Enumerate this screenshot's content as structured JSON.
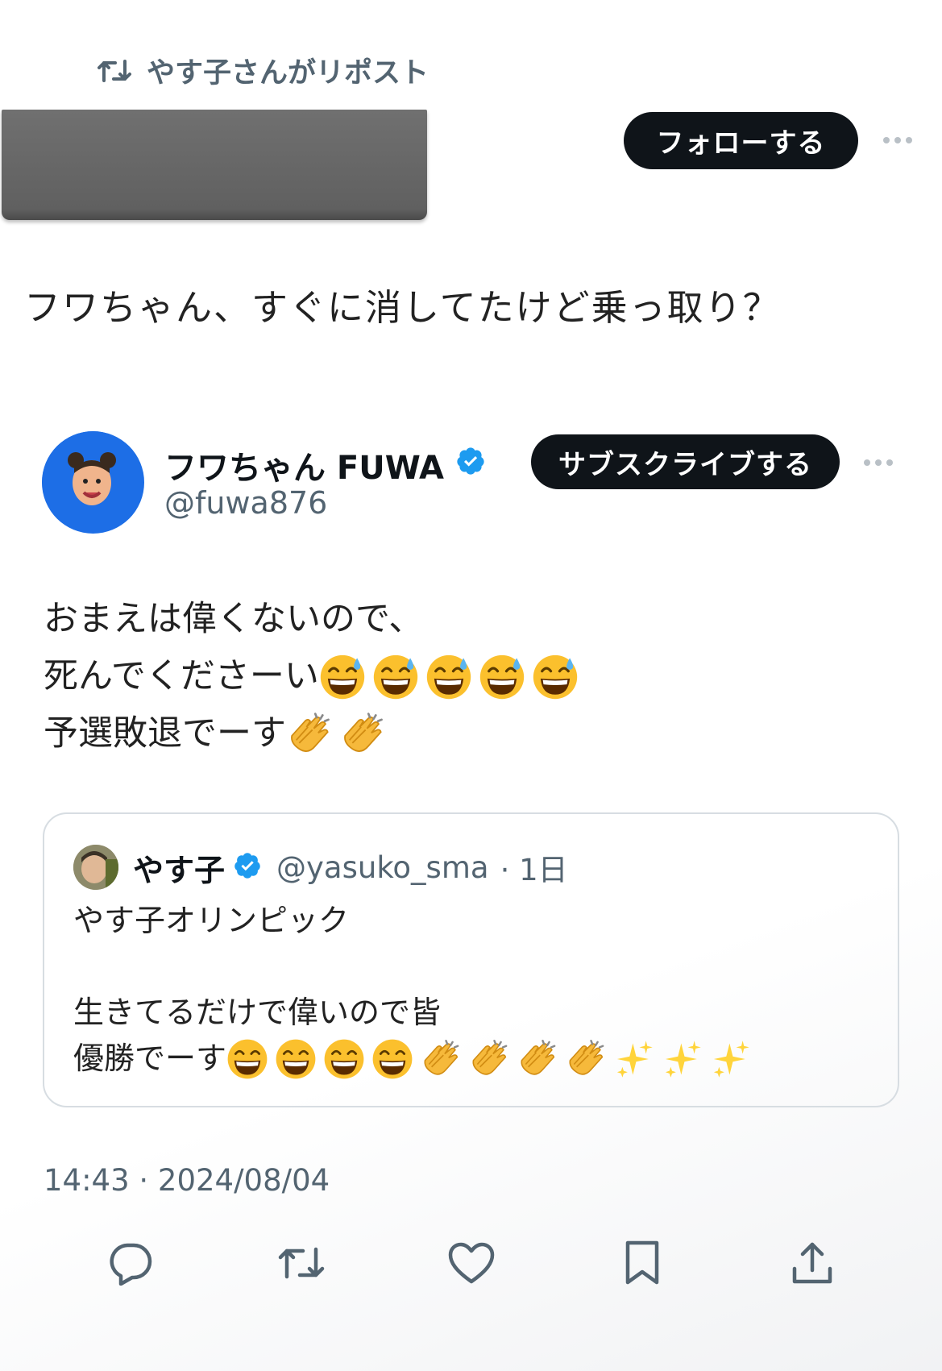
{
  "repost": {
    "icon": "repost-icon",
    "label": "やす子さんがリポスト"
  },
  "top": {
    "follow_label": "フォローする",
    "more_icon": "more-icon"
  },
  "quote_text": "フワちゃん、すぐに消してたけど乗っ取り？",
  "embedded": {
    "display_name": "フワちゃん FUWA",
    "handle": "@fuwa876",
    "subscribe_label": "サブスクライブする",
    "verified_color": "#1d9bf0",
    "body_lines": [
      {
        "text": "おまえは偉くないので、",
        "emojis": []
      },
      {
        "text": "死んでくださーい",
        "emojis": [
          "sweat-smile",
          "sweat-smile",
          "sweat-smile",
          "sweat-smile",
          "sweat-smile"
        ]
      },
      {
        "text": "予選敗退でーす",
        "emojis": [
          "clap",
          "clap"
        ]
      }
    ]
  },
  "quoted": {
    "display_name": "やす子",
    "handle": "@yasuko_sma",
    "time": "· 1日",
    "lines": [
      {
        "text": "やす子オリンピック",
        "emojis": []
      },
      {
        "text": "",
        "emojis": []
      },
      {
        "text": "生きてるだけで偉いので皆",
        "emojis": []
      },
      {
        "text": "優勝でーす",
        "emojis": [
          "grin",
          "grin",
          "grin",
          "grin",
          "clap",
          "clap",
          "clap",
          "clap",
          "sparkles",
          "sparkles",
          "sparkles"
        ]
      }
    ]
  },
  "timestamp": "14:43 · 2024/08/04",
  "actions": [
    {
      "name": "reply-icon"
    },
    {
      "name": "repost-action-icon"
    },
    {
      "name": "like-icon"
    },
    {
      "name": "bookmark-icon"
    },
    {
      "name": "share-icon"
    }
  ]
}
